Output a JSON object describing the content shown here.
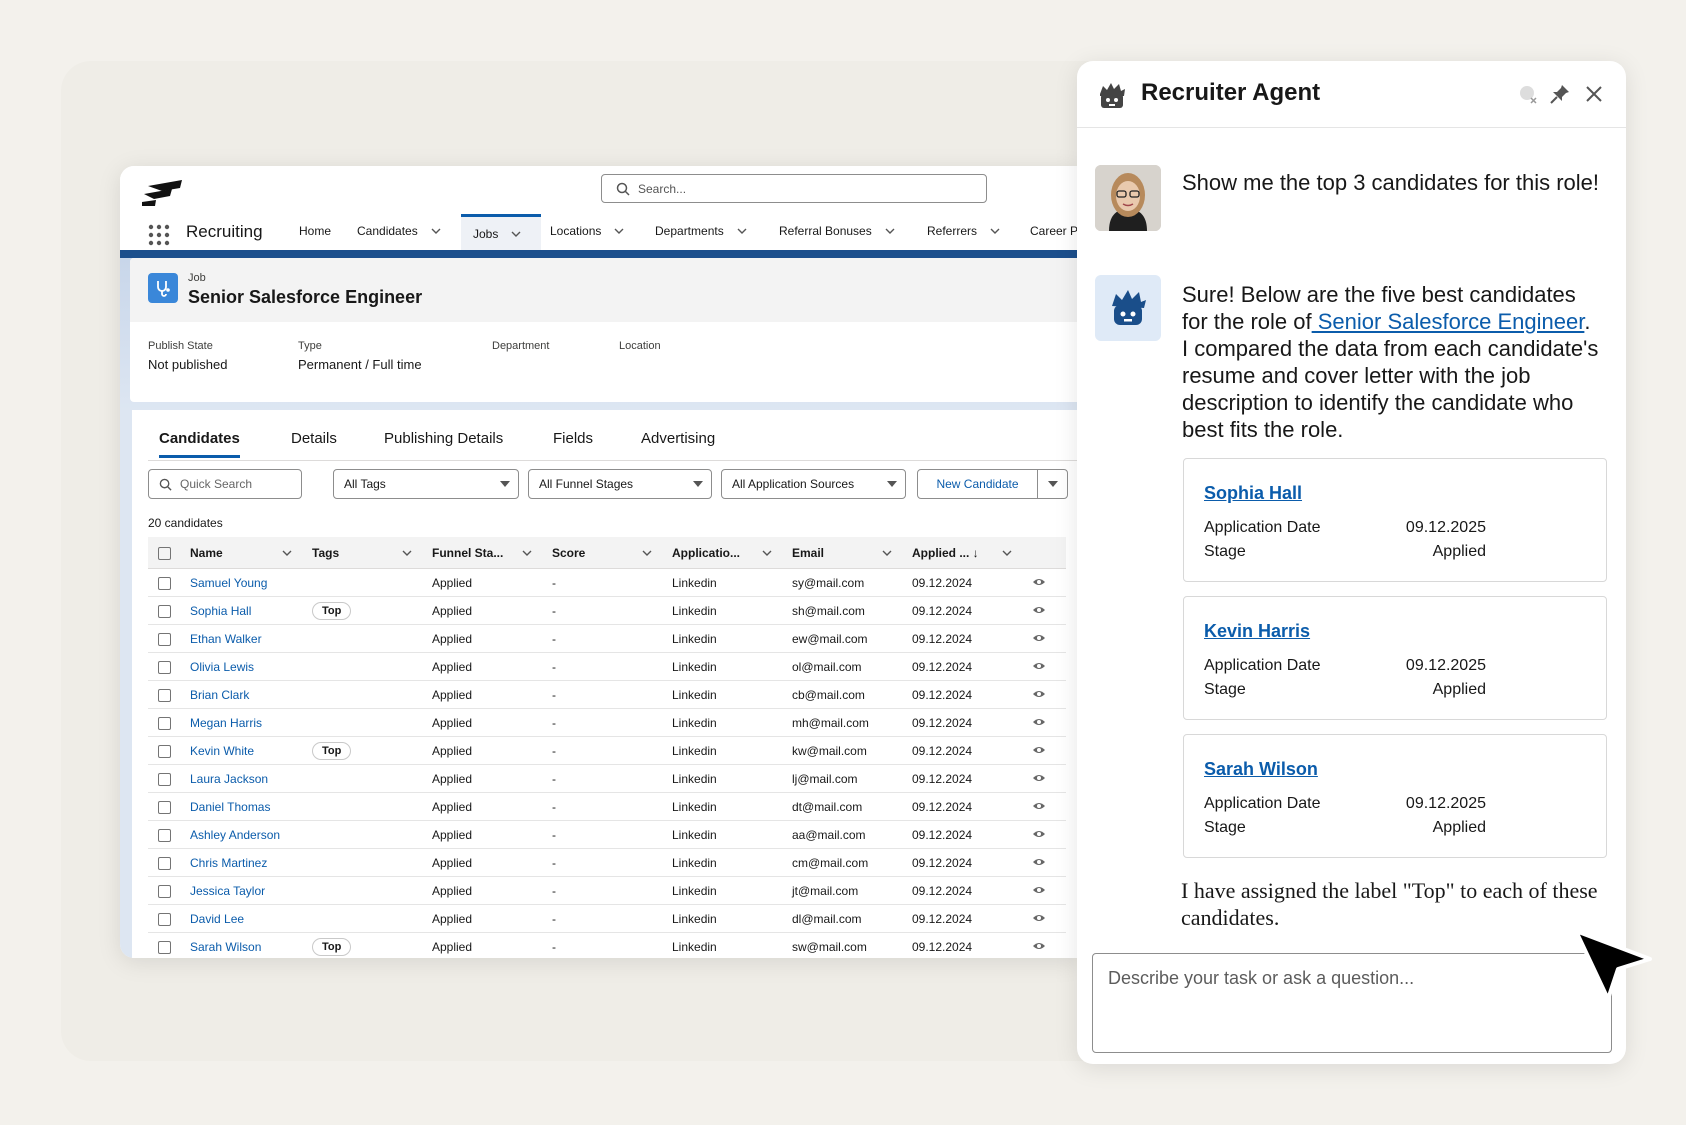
{
  "header": {
    "search_placeholder": "Search...",
    "app_name": "Recruiting",
    "nav": [
      {
        "label": "Home"
      },
      {
        "label": "Candidates"
      },
      {
        "label": "Jobs"
      },
      {
        "label": "Locations"
      },
      {
        "label": "Departments"
      },
      {
        "label": "Referral Bonuses"
      },
      {
        "label": "Referrers"
      },
      {
        "label": "Career P"
      }
    ]
  },
  "record": {
    "object_label": "Job",
    "title": "Senior Salesforce Engineer",
    "fields": [
      {
        "label": "Publish State",
        "value": "Not published"
      },
      {
        "label": "Type",
        "value": "Permanent / Full time"
      },
      {
        "label": "Department",
        "value": ""
      },
      {
        "label": "Location",
        "value": ""
      }
    ]
  },
  "tabs": [
    {
      "label": "Candidates"
    },
    {
      "label": "Details"
    },
    {
      "label": "Publishing Details"
    },
    {
      "label": "Fields"
    },
    {
      "label": "Advertising"
    }
  ],
  "filters": {
    "quick_search": "Quick Search",
    "tags": "All Tags",
    "funnel": "All Funnel Stages",
    "sources": "All Application Sources",
    "new_candidate": "New Candidate"
  },
  "count_text": "20 candidates",
  "table": {
    "columns": [
      "Name",
      "Tags",
      "Funnel Sta...",
      "Score",
      "Applicatio...",
      "Email",
      "Applied ... ↓"
    ],
    "rows": [
      {
        "name": "Samuel Young",
        "tag": "",
        "stage": "Applied",
        "score": "-",
        "source": "Linkedin",
        "email": "sy@mail.com",
        "applied": "09.12.2024"
      },
      {
        "name": "Sophia Hall",
        "tag": "Top",
        "stage": "Applied",
        "score": "-",
        "source": "Linkedin",
        "email": "sh@mail.com",
        "applied": "09.12.2024"
      },
      {
        "name": "Ethan Walker",
        "tag": "",
        "stage": "Applied",
        "score": "-",
        "source": "Linkedin",
        "email": "ew@mail.com",
        "applied": "09.12.2024"
      },
      {
        "name": "Olivia Lewis",
        "tag": "",
        "stage": "Applied",
        "score": "-",
        "source": "Linkedin",
        "email": "ol@mail.com",
        "applied": "09.12.2024"
      },
      {
        "name": "Brian Clark",
        "tag": "",
        "stage": "Applied",
        "score": "-",
        "source": "Linkedin",
        "email": "cb@mail.com",
        "applied": "09.12.2024"
      },
      {
        "name": "Megan Harris",
        "tag": "",
        "stage": "Applied",
        "score": "-",
        "source": "Linkedin",
        "email": "mh@mail.com",
        "applied": "09.12.2024"
      },
      {
        "name": "Kevin White",
        "tag": "Top",
        "stage": "Applied",
        "score": "-",
        "source": "Linkedin",
        "email": "kw@mail.com",
        "applied": "09.12.2024"
      },
      {
        "name": "Laura Jackson",
        "tag": "",
        "stage": "Applied",
        "score": "-",
        "source": "Linkedin",
        "email": "lj@mail.com",
        "applied": "09.12.2024"
      },
      {
        "name": "Daniel Thomas",
        "tag": "",
        "stage": "Applied",
        "score": "-",
        "source": "Linkedin",
        "email": "dt@mail.com",
        "applied": "09.12.2024"
      },
      {
        "name": "Ashley Anderson",
        "tag": "",
        "stage": "Applied",
        "score": "-",
        "source": "Linkedin",
        "email": "aa@mail.com",
        "applied": "09.12.2024"
      },
      {
        "name": "Chris Martinez",
        "tag": "",
        "stage": "Applied",
        "score": "-",
        "source": "Linkedin",
        "email": "cm@mail.com",
        "applied": "09.12.2024"
      },
      {
        "name": "Jessica Taylor",
        "tag": "",
        "stage": "Applied",
        "score": "-",
        "source": "Linkedin",
        "email": "jt@mail.com",
        "applied": "09.12.2024"
      },
      {
        "name": "David Lee",
        "tag": "",
        "stage": "Applied",
        "score": "-",
        "source": "Linkedin",
        "email": "dl@mail.com",
        "applied": "09.12.2024"
      },
      {
        "name": "Sarah Wilson",
        "tag": "Top",
        "stage": "Applied",
        "score": "-",
        "source": "Linkedin",
        "email": "sw@mail.com",
        "applied": "09.12.2024"
      }
    ]
  },
  "agent": {
    "title": "Recruiter Agent",
    "user_message": "Show me the top 3 candidates for this role!",
    "agent_message_before": "Sure! Below are the five best candidates for the role of",
    "agent_message_link": " Senior Salesforce Engineer",
    "agent_message_after": ". I compared the data from each candidate's resume and cover letter with the job description to identify the candidate who best fits the role.",
    "cards": [
      {
        "name": "Sophia Hall",
        "date_label": "Application Date",
        "date": "09.12.2025",
        "stage_label": "Stage",
        "stage": "Applied"
      },
      {
        "name": "Kevin Harris",
        "date_label": "Application Date",
        "date": "09.12.2025",
        "stage_label": "Stage",
        "stage": "Applied"
      },
      {
        "name": "Sarah Wilson",
        "date_label": "Application Date",
        "date": "09.12.2025",
        "stage_label": "Stage",
        "stage": "Applied"
      }
    ],
    "closing_message": "I have assigned the label \"Top\" to each of these candidates.",
    "input_placeholder": "Describe your task or ask a question..."
  },
  "colors": {
    "brand": "#0b5cab",
    "hero": "#1c4f8c",
    "job_icon": "#3a87d9"
  }
}
